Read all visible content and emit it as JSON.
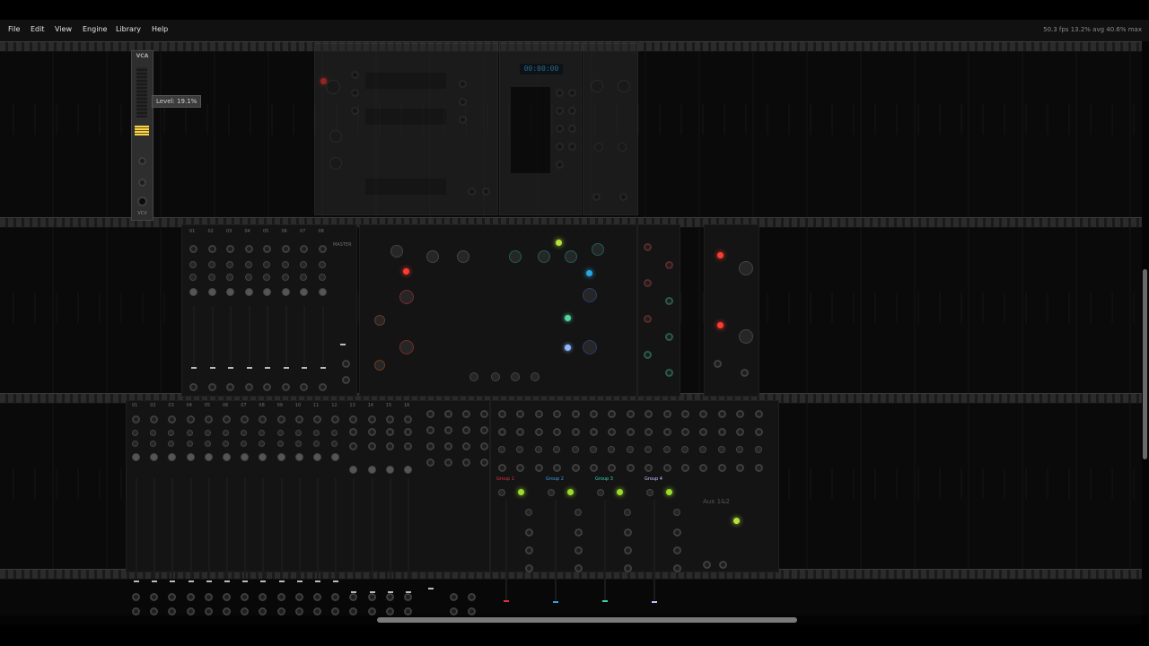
{
  "menu": {
    "file": "File",
    "edit": "Edit",
    "view": "View",
    "engine": "Engine",
    "library": "Library",
    "help": "Help"
  },
  "performance": "50.3 fps   13.2% avg   40.6% max",
  "vca": {
    "title": "VCA",
    "brand": "VCV",
    "level_fraction": 0.191
  },
  "tooltip": "Level: 19.1%",
  "clock_display": "00:00:00",
  "mixer_top": {
    "channels": [
      "01",
      "02",
      "03",
      "04",
      "05",
      "06",
      "07",
      "08"
    ],
    "master": "MASTER"
  },
  "mixer_bottom": {
    "channels": [
      "01",
      "02",
      "03",
      "04",
      "05",
      "06",
      "07",
      "08",
      "09",
      "10",
      "11",
      "12",
      "13",
      "14",
      "15",
      "16"
    ],
    "groups": [
      "Group 1",
      "Group 2",
      "Group 3",
      "Group 4"
    ],
    "aux": "Aux 1&2"
  },
  "colors": {
    "accent_yellow": "#f7d24a",
    "led_red": "#ff3b30",
    "led_green": "#9bdc2c",
    "group1": "#e0303a",
    "group2": "#3aa0e0",
    "group3": "#3ad0b0",
    "group4": "#c0c0ff"
  }
}
